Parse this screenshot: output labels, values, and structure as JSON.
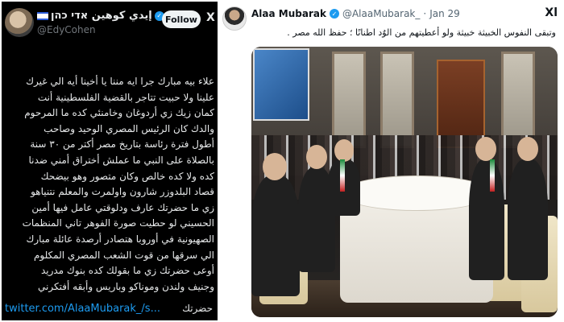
{
  "left_tweet": {
    "display_name": "إيدي كوهين אדי כהן",
    "handle": "@EdyCohen",
    "follow_label": "Follow",
    "x_logo": "X",
    "body_lines": [
      "علاء بيه مبارك جرا ايه مننا يا أخينا أيه الي غيرك",
      "علينا ولا حبيت تتاجر بالقضية الفلسطينية أنت",
      "كمان زيك زي أردوغان وخامنئي كده ما المرحوم",
      "والدك كان الرئيس المصري الوحيد وصاحب",
      "أطول فترة رئاسة بتاريخ مصر أكتر من ٣٠ سنة",
      "بالصلاة على النبي ما عملش أختراق أمني ضدنا",
      "كده ولا كده خالص وكان متصور وهو بيضحك",
      "قصاد البلدوزر شارون واولمرت والمعلم نتنياهو",
      "زي ما حضرتك عارف ودلوقتي عامل فيها أمين",
      "الحسيني لو حطيت صورة الفوهر تاني المنظمات",
      "الصهيونية في أوروبا هتصادر أرصدة عائلة مبارك",
      "الي سرقها من قوت الشعب المصري المكلوم",
      "أوعى حضرتك زي ما بقولك كده بنوك مدريد",
      "وجنيف ولندن وموناكو وباريس وأبقه أفتكرني"
    ],
    "link_text": "twitter.com/AlaaMubarak_/s...",
    "link_tail": "حضرتك"
  },
  "right_tweet": {
    "display_name": "Alaa Mubarak",
    "handle": "@AlaaMubarak_",
    "separator": "·",
    "date": "Jan 29",
    "menu_label": "Xl",
    "text": "وتبقى النفوس الخبيثة خبيثة ولو أعطيتهم من الوُد اطنانًا ؛ حفظ الله مصر ."
  }
}
